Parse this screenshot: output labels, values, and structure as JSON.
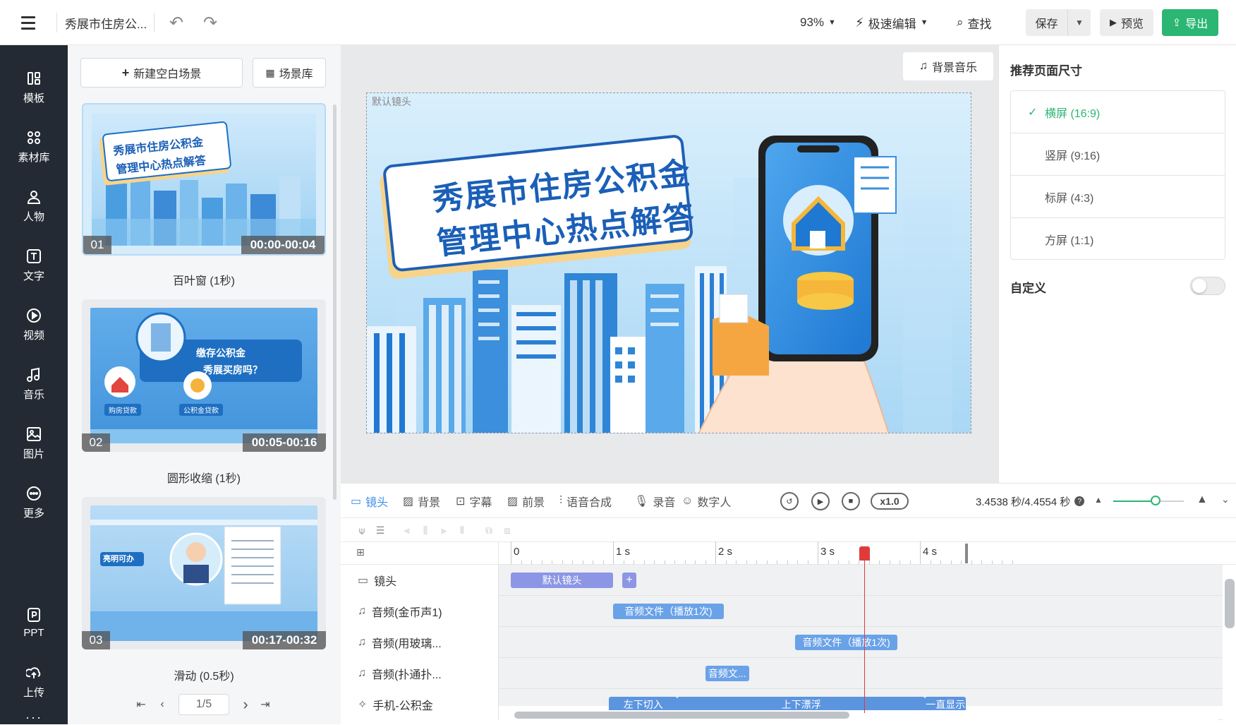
{
  "header": {
    "doc_title": "秀展市住房公...",
    "zoom": "93%",
    "speed_edit": "极速编辑",
    "find": "查找",
    "save": "保存",
    "preview": "预览",
    "export": "导出"
  },
  "sidebar": {
    "items": [
      {
        "label": "模板",
        "icon": "template-icon"
      },
      {
        "label": "素材库",
        "icon": "material-icon"
      },
      {
        "label": "人物",
        "icon": "person-icon"
      },
      {
        "label": "文字",
        "icon": "text-icon"
      },
      {
        "label": "视频",
        "icon": "video-icon"
      },
      {
        "label": "音乐",
        "icon": "music-icon"
      },
      {
        "label": "图片",
        "icon": "image-icon"
      },
      {
        "label": "更多",
        "icon": "more-icon"
      },
      {
        "label": "PPT",
        "icon": "ppt-icon"
      },
      {
        "label": "上传",
        "icon": "upload-icon"
      }
    ]
  },
  "scenes": {
    "new_scene": "新建空白场景",
    "library": "场景库",
    "items": [
      {
        "num": "01",
        "time": "00:00-00:04",
        "label": "百叶窗 (1秒)",
        "thumb_title_1": "秀展市住房公积金",
        "thumb_title_2": "管理中心热点解答"
      },
      {
        "num": "02",
        "time": "00:05-00:16",
        "label": "圆形收缩 (1秒)",
        "thumb_title_1": "缴存公积金",
        "thumb_title_2": "秀展买房吗？",
        "tag_a": "购房贷款",
        "tag_b": "公积金贷款"
      },
      {
        "num": "03",
        "time": "00:17-00:32",
        "label": "滑动 (0.5秒)",
        "tag": "亮明可办"
      }
    ],
    "page": "1/5"
  },
  "canvas": {
    "bgm": "背景音乐",
    "lens_label": "默认镜头",
    "title_line1": "秀展市住房公积金",
    "title_line2": "管理中心热点解答"
  },
  "page_size": {
    "title": "推荐页面尺寸",
    "options": [
      "横屏 (16:9)",
      "竖屏 (9:16)",
      "标屏 (4:3)",
      "方屏 (1:1)"
    ],
    "selected_index": 0,
    "custom_label": "自定义",
    "custom_enabled": false
  },
  "timeline": {
    "tabs": [
      "镜头",
      "背景",
      "字幕",
      "前景",
      "语音合成",
      "录音",
      "数字人"
    ],
    "speed": "x1.0",
    "time_readout": "3.4538 秒/4.4554 秒",
    "zoom_fraction": 0.6,
    "ruler": [
      "0",
      "1 s",
      "2 s",
      "3 s",
      "4 s"
    ],
    "playhead_seconds": 3.4538,
    "total_seconds": 4.4554,
    "tracks": [
      {
        "name": "镜头",
        "icon": "camera-icon",
        "clips": [
          {
            "label": "默认镜头",
            "start": 0,
            "end": 1.0,
            "color": "#8c96e4"
          }
        ],
        "add_label": "+"
      },
      {
        "name": "音频(金币声1)",
        "icon": "music-icon",
        "clips": [
          {
            "label": "音频文件（播放1次)",
            "start": 1.0,
            "end": 2.08,
            "color": "#6aa2e8"
          }
        ]
      },
      {
        "name": "音频(用玻璃...",
        "icon": "music-icon",
        "clips": [
          {
            "label": "音频文件（播放1次)",
            "start": 2.78,
            "end": 3.78,
            "color": "#6aa2e8"
          }
        ]
      },
      {
        "name": "音频(扑通扑...",
        "icon": "music-icon",
        "clips": [
          {
            "label": "音频文...",
            "start": 1.9,
            "end": 2.33,
            "color": "#6aa2e8"
          }
        ]
      },
      {
        "name": "手机-公积金",
        "icon": "element-icon",
        "clips": [
          {
            "label": "左下切入",
            "start": 0.96,
            "end": 1.63,
            "color": "#5b95e0"
          },
          {
            "label": "上下漂浮",
            "start": 1.63,
            "end": 4.05,
            "color": "#5b95e0"
          },
          {
            "label": "一直显示",
            "start": 4.05,
            "end": 4.45,
            "color": "#5b95e0"
          }
        ]
      }
    ]
  }
}
